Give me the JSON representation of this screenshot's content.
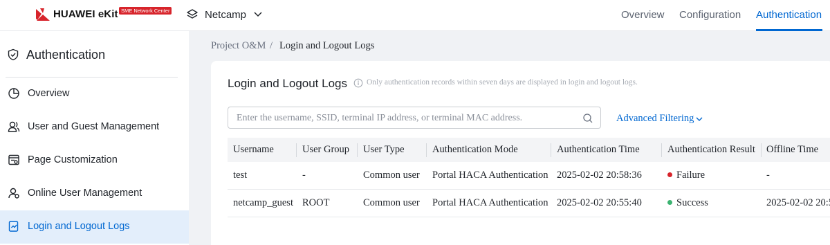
{
  "header": {
    "brand": "HUAWEI eKit",
    "badge": "SME Network Center",
    "site": "Netcamp",
    "nav": [
      "Overview",
      "Configuration",
      "Authentication"
    ],
    "active_nav": "Authentication",
    "accent": "#0067d1",
    "brand_red": "#d7242b"
  },
  "sidebar": {
    "title": "Authentication",
    "items": [
      {
        "label": "Overview",
        "icon": "pie-chart-icon"
      },
      {
        "label": "User and Guest Management",
        "icon": "users-icon"
      },
      {
        "label": "Page Customization",
        "icon": "page-icon"
      },
      {
        "label": "Online User Management",
        "icon": "user-online-icon"
      },
      {
        "label": "Login and Logout Logs",
        "icon": "log-icon",
        "active": true
      }
    ]
  },
  "breadcrumb": {
    "parent": "Project O&M",
    "separator": "/",
    "current": "Login and Logout Logs"
  },
  "main": {
    "title": "Login and Logout Logs",
    "hint": "Only authentication records within seven days are displayed in login and logout logs.",
    "search_placeholder": "Enter the username, SSID, terminal IP address, or terminal MAC address.",
    "advanced_filter": "Advanced Filtering"
  },
  "table": {
    "columns": [
      "Username",
      "User Group",
      "User Type",
      "Authentication Mode",
      "Authentication Time",
      "Authentication Result",
      "Offline Time"
    ],
    "rows": [
      {
        "username": "test",
        "group": "-",
        "type": "Common user",
        "mode": "Portal HACA Authentication",
        "time": "2025-02-02 20:58:36",
        "result": "Failure",
        "result_color": "#d7242b",
        "offline": "-"
      },
      {
        "username": "netcamp_guest",
        "group": "ROOT",
        "type": "Common user",
        "mode": "Portal HACA Authentication",
        "time": "2025-02-02 20:55:40",
        "result": "Success",
        "result_color": "#3cb371",
        "offline": "2025-02-02 20:5"
      }
    ]
  }
}
